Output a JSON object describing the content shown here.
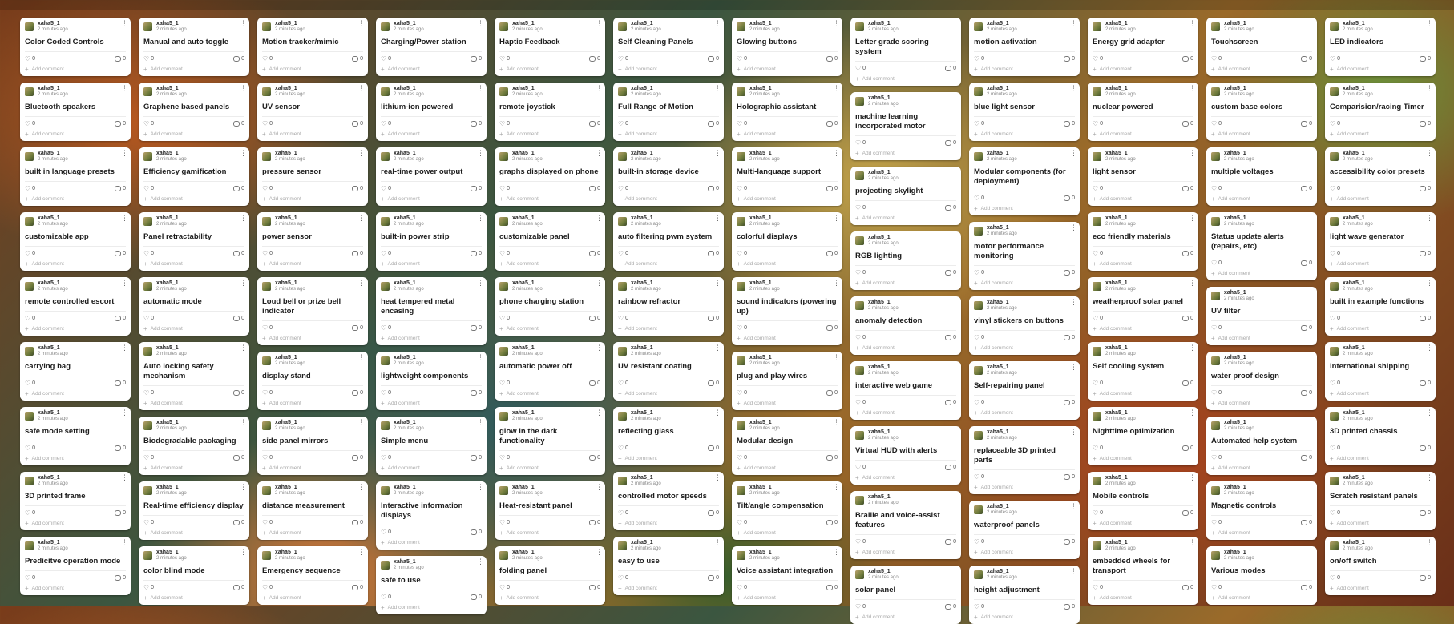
{
  "card_meta": {
    "author": "xaha5_1",
    "time": "2 minutes ago",
    "likes": "0",
    "comments": "0",
    "add_comment": "Add comment"
  },
  "columns": [
    [
      "Color Coded Controls",
      "Bluetooth speakers",
      "built in language presets",
      "customizable app",
      "remote controlled escort",
      "carrying bag",
      "safe mode setting",
      "3D printed frame",
      "Predicitve operation mode"
    ],
    [
      "Manual and auto toggle",
      "Graphene based panels",
      "Efficiency gamification",
      "Panel retractability",
      "automatic mode",
      "Auto locking safety mechanism",
      "Biodegradable packaging",
      "Real-time efficiency display",
      "color blind mode"
    ],
    [
      "Motion tracker/mimic",
      "UV sensor",
      "pressure sensor",
      "power sensor",
      "Loud bell or prize bell indicator",
      "display stand",
      "side panel mirrors",
      "distance measurement",
      "Emergency sequence"
    ],
    [
      "Charging/Power station",
      "lithium-ion powered",
      "real-time power output",
      "built-in power strip",
      "heat tempered metal encasing",
      "lightweight components",
      "Simple menu",
      "Interactive information displays",
      "safe to use"
    ],
    [
      "Haptic Feedback",
      "remote joystick",
      "graphs displayed on phone",
      "customizable panel",
      "phone charging station",
      "automatic power off",
      "glow in the dark functionality",
      "Heat-resistant panel",
      "folding panel"
    ],
    [
      "Self Cleaning Panels",
      "Full Range of Motion",
      "built-in storage device",
      "auto filtering pwm system",
      "rainbow refractor",
      "UV resistant coating",
      "reflecting glass",
      "controlled motor speeds",
      "easy to use"
    ],
    [
      "Glowing  buttons",
      "Holographic assistant",
      "Multi-language support",
      "colorful displays",
      "sound indicators (powering up)",
      "plug and play wires",
      "Modular design",
      "Tilt/angle compensation",
      "Voice assistant integration"
    ],
    [
      "Letter grade scoring system",
      "machine learning incorporated motor",
      "projecting skylight",
      "RGB lighting",
      "anomaly detection",
      "interactive web game",
      "Virtual HUD with alerts",
      "Braille and voice-assist features",
      "solar panel"
    ],
    [
      "motion activation",
      "blue light sensor",
      "Modular components (for deployment)",
      "motor performance monitoring",
      "vinyl stickers on buttons",
      "Self-repairing panel",
      "replaceable 3D printed parts",
      "waterproof panels",
      "height adjustment"
    ],
    [
      "Energy grid adapter",
      "nuclear powered",
      "light sensor",
      "eco friendly materials",
      "weatherproof solar panel",
      "Self cooling system",
      "Nighttime optimization",
      "Mobile controls",
      "embedded wheels for transport"
    ],
    [
      "Touchscreen",
      "custom base colors",
      "multiple voltages",
      "Status update alerts (repairs, etc)",
      "UV filter",
      "water proof design",
      "Automated help system",
      "Magnetic controls",
      "Various modes"
    ],
    [
      "LED indicators",
      "Comparision/racing Timer",
      "accessibility color presets",
      "light wave generator",
      "built in example functions",
      "international shipping",
      "3D printed chassis",
      "Scratch resistant panels",
      "on/off switch"
    ]
  ]
}
